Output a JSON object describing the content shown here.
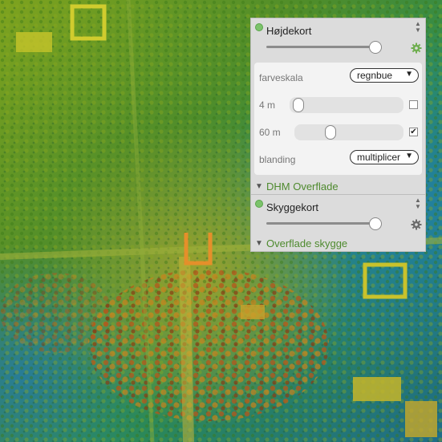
{
  "layers": {
    "hoejdekort": {
      "title": "Højdekort",
      "opacity": 1.0,
      "settings": {
        "colorscale_label": "farveskala",
        "colorscale_value": "regnbue",
        "min_label": "4 m",
        "min_checked": false,
        "max_label": "60 m",
        "max_checked": true,
        "blend_label": "blanding",
        "blend_value": "multiplicer"
      },
      "source_label": "DHM Overflade"
    },
    "skyggekort": {
      "title": "Skyggekort",
      "opacity": 1.0,
      "source_label": "Overflade skygge"
    }
  },
  "icons": {
    "visibility": "layer-visible-dot-icon",
    "reorder": "up-down-arrows-icon",
    "settings": "gear-icon",
    "collapse": "triangle-down-icon",
    "dropdown": "triangle-down-icon",
    "check": "checkmark-icon"
  },
  "colors": {
    "panel_bg": "#dcdcdc",
    "accent_green": "#4e8a2e",
    "gear_active": "#6fae4f",
    "gear_inactive": "#6b6b6b"
  }
}
